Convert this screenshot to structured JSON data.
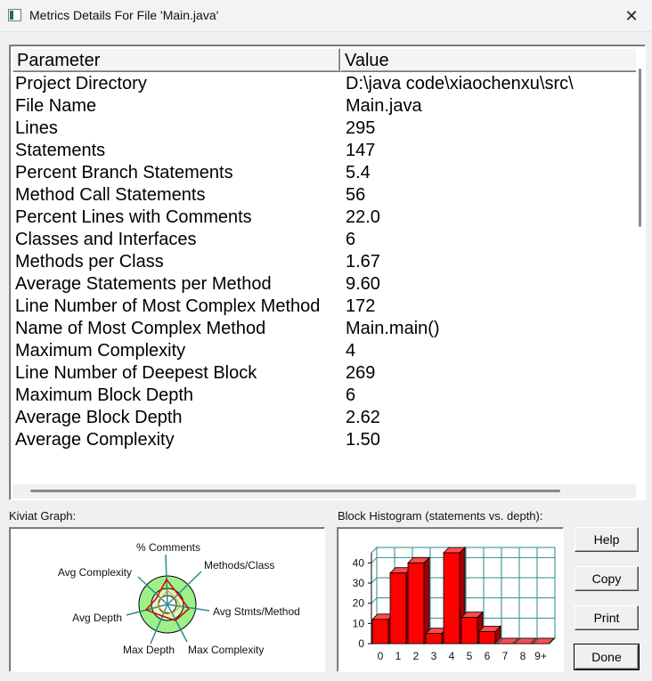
{
  "window": {
    "title": "Metrics Details For File 'Main.java'",
    "close_glyph": "✕"
  },
  "table": {
    "headers": {
      "parameter": "Parameter",
      "value": "Value"
    },
    "rows": [
      {
        "param": "Project Directory",
        "value": "D:\\java code\\xiaochenxu\\src\\"
      },
      {
        "param": "File Name",
        "value": "Main.java"
      },
      {
        "param": "Lines",
        "value": "295"
      },
      {
        "param": "Statements",
        "value": "147"
      },
      {
        "param": "Percent Branch Statements",
        "value": "5.4"
      },
      {
        "param": "Method Call Statements",
        "value": "56"
      },
      {
        "param": "Percent Lines with Comments",
        "value": "22.0"
      },
      {
        "param": "Classes and Interfaces",
        "value": "6"
      },
      {
        "param": "Methods per Class",
        "value": "1.67"
      },
      {
        "param": "Average Statements per Method",
        "value": "9.60"
      },
      {
        "param": "Line Number of Most Complex Method",
        "value": "172"
      },
      {
        "param": "Name of Most Complex Method",
        "value": "Main.main()"
      },
      {
        "param": "Maximum Complexity",
        "value": "4"
      },
      {
        "param": "Line Number of Deepest Block",
        "value": "269"
      },
      {
        "param": "Maximum Block Depth",
        "value": "6"
      },
      {
        "param": "Average Block Depth",
        "value": "2.62"
      },
      {
        "param": "Average Complexity",
        "value": "1.50"
      }
    ]
  },
  "kiviat": {
    "label": "Kiviat Graph:",
    "axes": [
      "% Comments",
      "Methods/Class",
      "Avg Stmts/Method",
      "Max Complexity",
      "Max Depth",
      "Avg Depth",
      "Avg Complexity"
    ]
  },
  "histogram": {
    "label": "Block Histogram (statements vs. depth):",
    "bar_color": "#ff0000",
    "grid_color": "#2e8b8b"
  },
  "chart_data": {
    "type": "bar",
    "categories": [
      "0",
      "1",
      "2",
      "3",
      "4",
      "5",
      "6",
      "7",
      "8",
      "9+"
    ],
    "values": [
      12,
      35,
      40,
      5,
      45,
      13,
      6,
      0,
      0,
      0
    ],
    "ylim": [
      0,
      45
    ],
    "yticks": [
      "0",
      "10",
      "20",
      "30",
      "40"
    ],
    "grid": true
  },
  "buttons": {
    "help": "Help",
    "copy": "Copy",
    "print": "Print",
    "done": "Done"
  }
}
